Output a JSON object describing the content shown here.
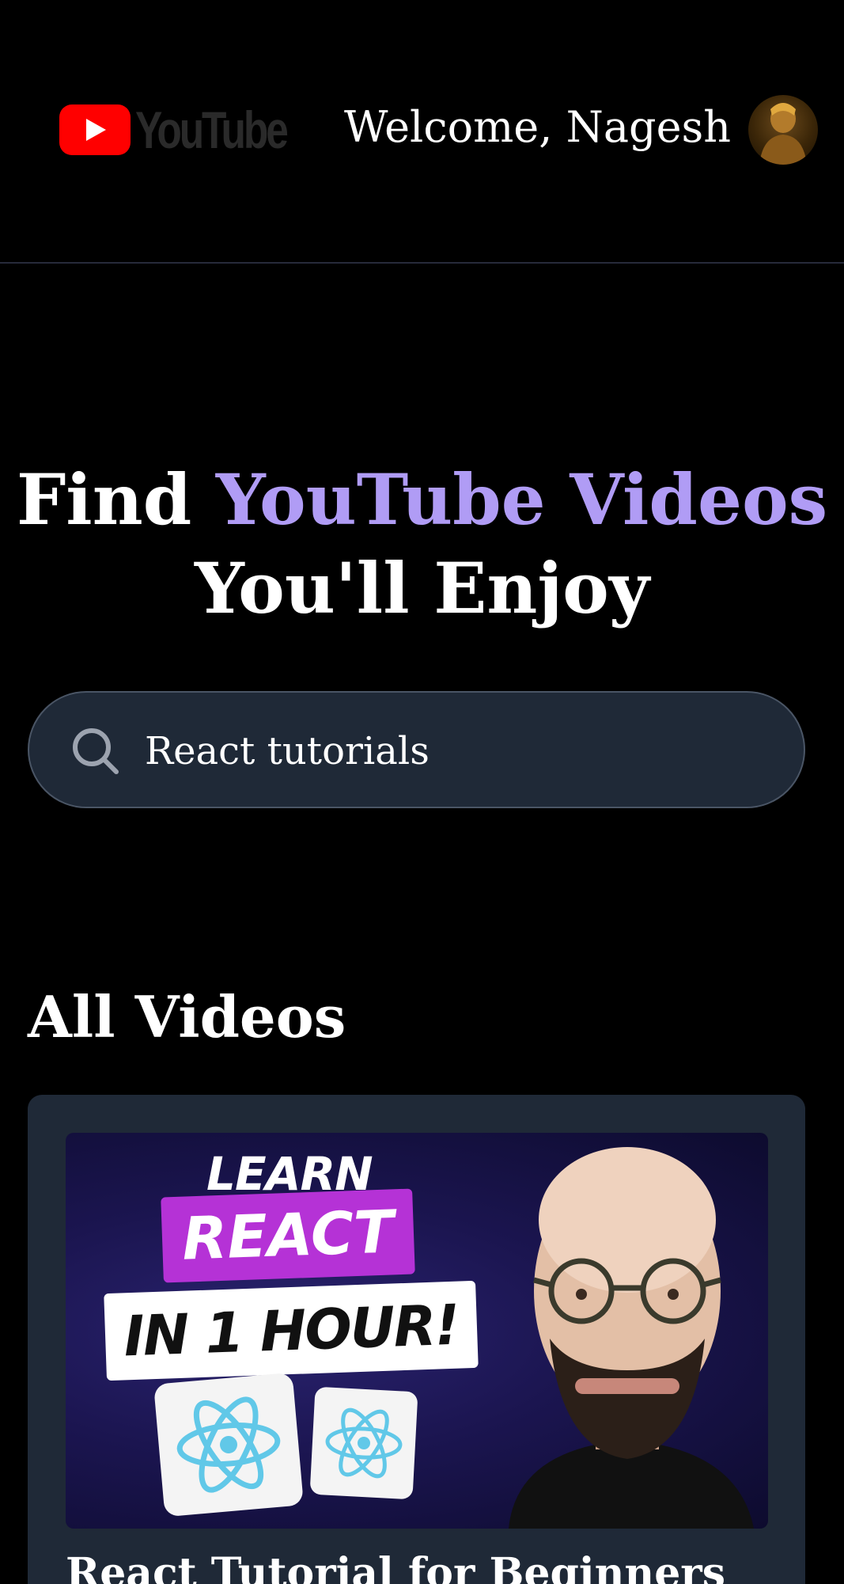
{
  "header": {
    "logo_text": "YouTube",
    "welcome": "Welcome, Nagesh"
  },
  "hero": {
    "prefix": "Find ",
    "accent": "YouTube Videos",
    "line2": "You'll Enjoy"
  },
  "search": {
    "value": "React tutorials"
  },
  "section": {
    "title": "All Videos"
  },
  "videos": [
    {
      "thumb_learn": "LEARN",
      "thumb_react": "REACT",
      "thumb_hour": "IN 1 HOUR!",
      "title": "React Tutorial for Beginners"
    }
  ],
  "colors": {
    "background": "#000000",
    "accent": "#b09cf5",
    "card": "#1f2937",
    "youtube_red": "#ff0000"
  }
}
